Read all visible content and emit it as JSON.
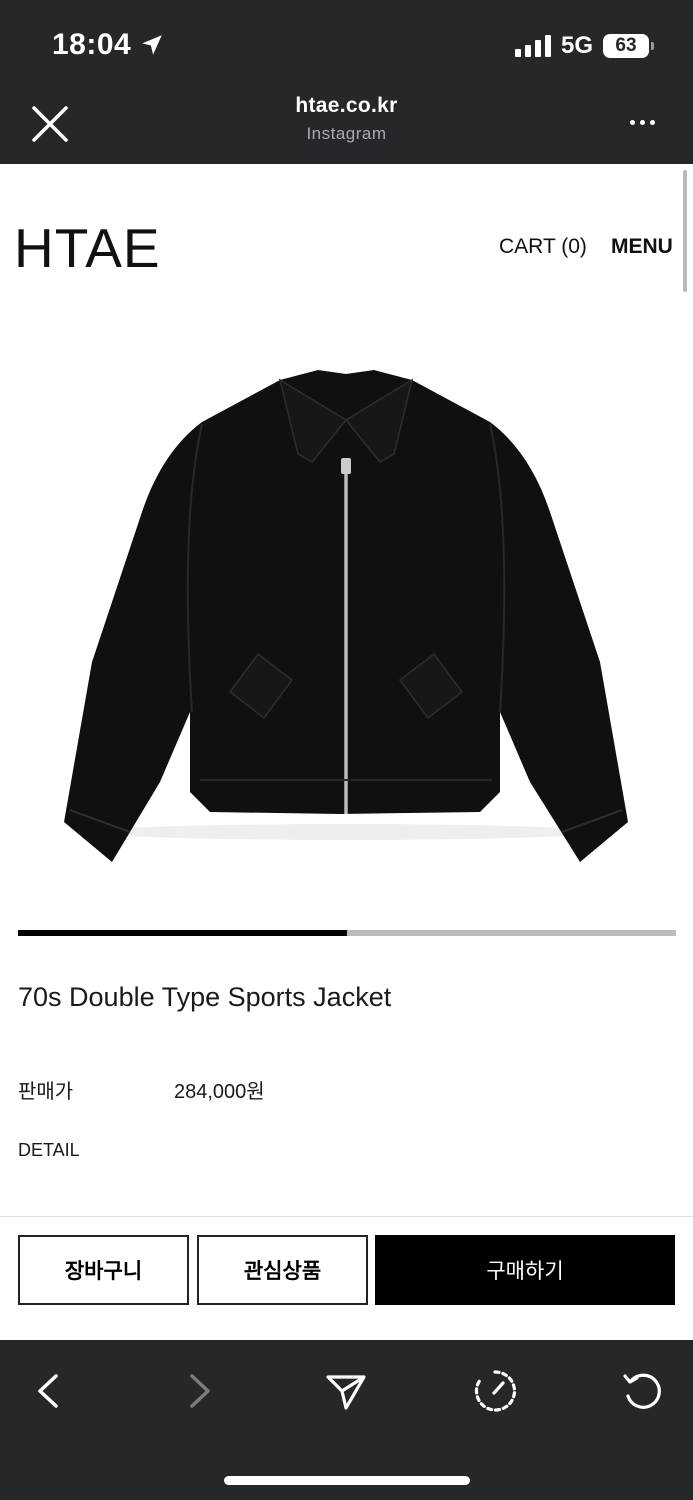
{
  "status_bar": {
    "time": "18:04",
    "network": "5G",
    "battery": "63"
  },
  "browser": {
    "url_host": "htae.co.kr",
    "source_label": "Instagram",
    "icons": [
      "close-icon",
      "more-icon",
      "back-icon",
      "forward-icon",
      "share-icon",
      "speed-icon",
      "reload-icon"
    ]
  },
  "site": {
    "logo": "HTAE",
    "cart_label": "CART (0)",
    "menu_label": "MENU"
  },
  "product": {
    "image_alt_icon": "black-zip-jacket",
    "gallery_progress": 0.5,
    "title": "70s Double Type Sports Jacket",
    "price_label": "판매가",
    "price_value": "284,000원",
    "detail_label": "DETAIL"
  },
  "actions": {
    "cart_button": "장바구니",
    "wishlist_button": "관심상품",
    "buy_button": "구매하기"
  },
  "colors": {
    "chrome_dark": "#26272b",
    "buy_button_bg": "#000000",
    "progress_track": "#bcbcbc"
  }
}
